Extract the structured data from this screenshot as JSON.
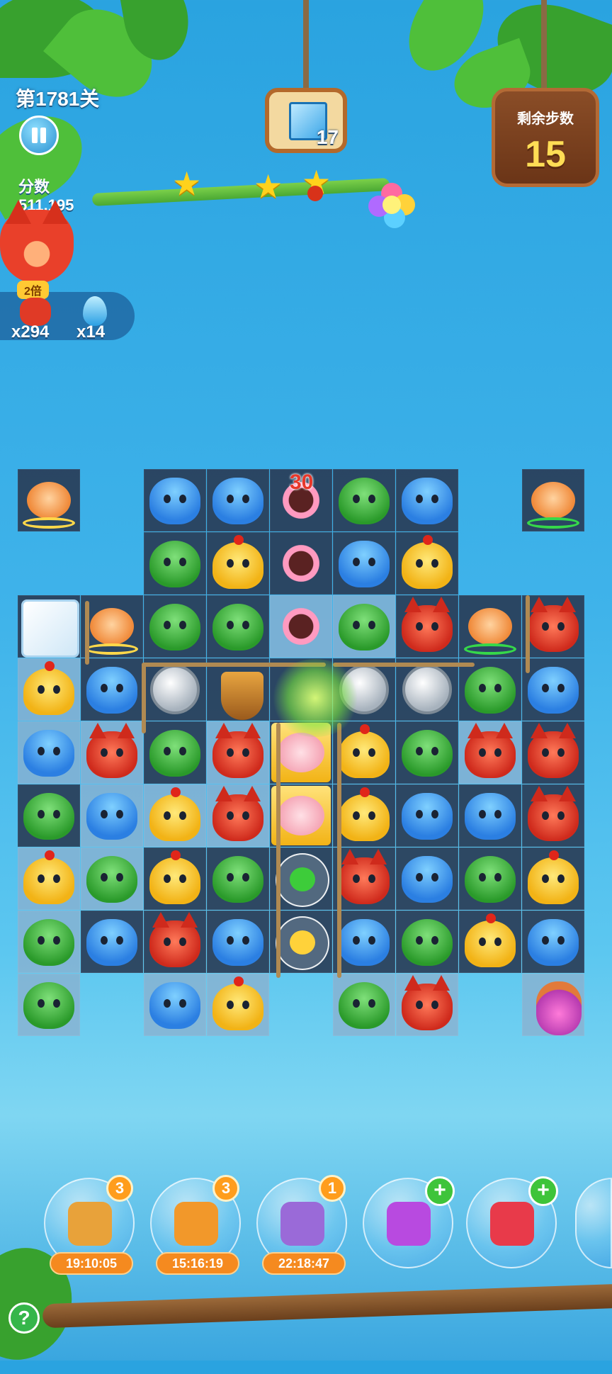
{
  "hud": {
    "level": "第1781关",
    "score_label": "分数",
    "score_value": "511,195",
    "goal_count": "17",
    "moves_label": "剩余步数",
    "moves_value": "15",
    "multiplier": "2倍",
    "fox_count": "x294",
    "drop_count": "x14",
    "stars_earned": 3
  },
  "board": {
    "blocker_counter": "30"
  },
  "boosters": [
    {
      "icon": "shuffle-board-icon",
      "badge": "3",
      "timer": "19:10:05"
    },
    {
      "icon": "clock-icon",
      "badge": "3",
      "timer": "15:16:19"
    },
    {
      "icon": "swap-pieces-icon",
      "badge": "1",
      "timer": "22:18:47"
    },
    {
      "icon": "horizontal-rocket-icon",
      "badge": "+",
      "timer": ""
    },
    {
      "icon": "vertical-rocket-icon",
      "badge": "+",
      "timer": ""
    }
  ],
  "help_label": "?",
  "colors": {
    "sky": "#3fb3ea",
    "wood": "#7a3f1c",
    "accent": "#ff9d1c",
    "moves": "#ffdd55"
  }
}
